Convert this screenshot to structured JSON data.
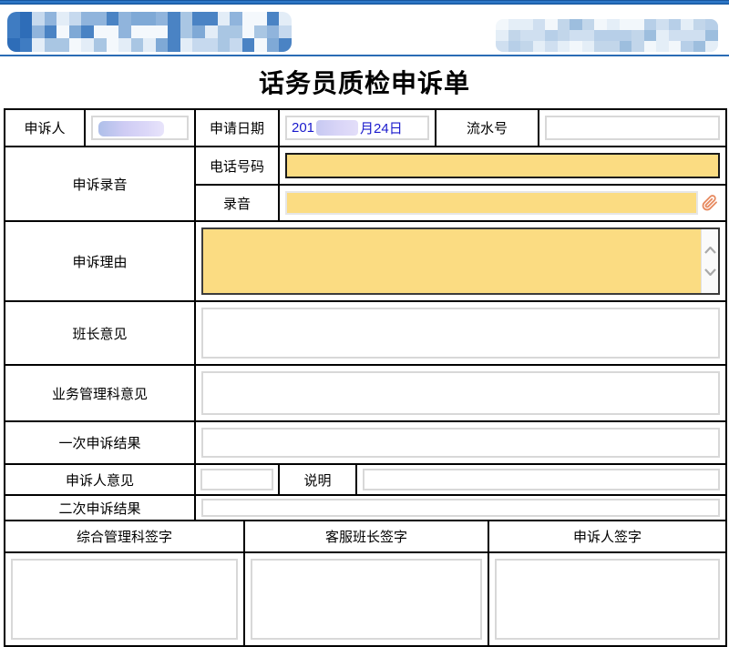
{
  "title": "话务员质检申诉单",
  "date": {
    "prefix": "201",
    "suffix": "月24日"
  },
  "labels": {
    "applicant": "申诉人",
    "apply_date": "申请日期",
    "serial_no": "流水号",
    "appeal_recording": "申诉录音",
    "phone_number": "电话号码",
    "recording": "录音",
    "appeal_reason": "申诉理由",
    "monitor_opinion": "班长意见",
    "business_mgmt_opinion": "业务管理科意见",
    "first_appeal_result": "一次申诉结果",
    "appellant_opinion": "申诉人意见",
    "explanation": "说明",
    "second_appeal_result": "二次申诉结果"
  },
  "signatures": [
    {
      "label": "综合管理科签字"
    },
    {
      "label": "客服班长签字"
    },
    {
      "label": "申诉人签字"
    }
  ],
  "fields": {
    "applicant_value": "",
    "serial_value": "",
    "phone_value": "",
    "recording_value": "",
    "reason_value": "",
    "monitor_value": "",
    "business_value": "",
    "first_result_value": "",
    "appellant_opinion_value": "",
    "explanation_value": "",
    "second_result_value": ""
  },
  "icons": {
    "attachment": "paperclip-icon",
    "scroll_up": "chevron-up-icon",
    "scroll_down": "chevron-down-icon",
    "logo": "blurred-logo"
  },
  "colors": {
    "top_bar": "#1f62ae",
    "rule_line": "#2a6cb5",
    "highlight_field": "#fbdc82",
    "date_text": "#1a1acc",
    "table_border": "#000000",
    "input_border": "#d8d8d8",
    "paperclip": "#e78a60",
    "scroll_arrow": "#a9a9a9",
    "blur_tint": "#d5d1f5"
  },
  "logo_blur": {
    "left": {
      "cols": 23,
      "rows": 3,
      "seed": 7,
      "head_cols": 2,
      "head_palette": [
        "#2e6db8",
        "#3f7cc2",
        "#5b8fcb"
      ],
      "palette": [
        "#4a83c4",
        "#7fa9d6",
        "#a9c6e3",
        "#c6d9ee",
        "#e3edf7",
        "#f4f8fc",
        "#90b4dc"
      ]
    },
    "right": {
      "cols": 18,
      "rows": 3,
      "seed": 21,
      "head_cols": 0,
      "head_palette": [],
      "palette": [
        "#9dbede",
        "#b7cfe8",
        "#cfdff0",
        "#e4eef7",
        "#f2f7fb",
        "#c2d6ea"
      ]
    }
  }
}
